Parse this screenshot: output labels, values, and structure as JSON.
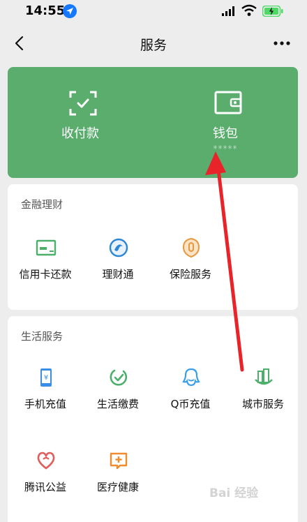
{
  "status_bar": {
    "time": "14:55"
  },
  "nav": {
    "title": "服务"
  },
  "wallet_card": {
    "items": [
      {
        "label": "收付款",
        "icon": "scan-pay-icon"
      },
      {
        "label": "钱包",
        "icon": "wallet-icon",
        "masked": "*****"
      }
    ],
    "color": "#5aad6d"
  },
  "finance": {
    "title": "金融理财",
    "items": [
      {
        "label": "信用卡还款",
        "icon": "credit-card-icon"
      },
      {
        "label": "理财通",
        "icon": "licaitong-icon"
      },
      {
        "label": "保险服务",
        "icon": "insurance-icon"
      }
    ]
  },
  "life": {
    "title": "生活服务",
    "items": [
      {
        "label": "手机充值",
        "icon": "phone-recharge-icon"
      },
      {
        "label": "生活缴费",
        "icon": "utility-payment-icon"
      },
      {
        "label": "Q币充值",
        "icon": "qq-coin-icon"
      },
      {
        "label": "城市服务",
        "icon": "city-service-icon"
      },
      {
        "label": "腾讯公益",
        "icon": "charity-icon"
      },
      {
        "label": "医疗健康",
        "icon": "medical-icon"
      }
    ]
  },
  "watermark": "Bai 经验"
}
